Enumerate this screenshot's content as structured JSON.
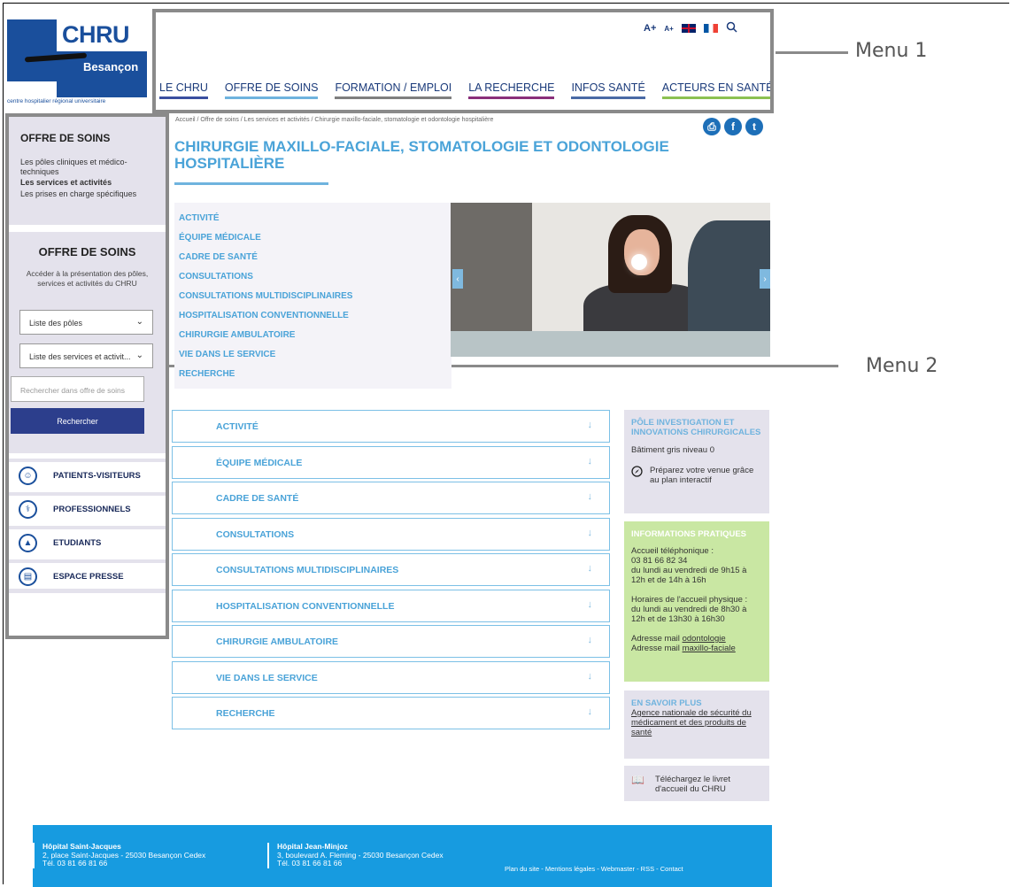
{
  "logo": {
    "name": "CHRU",
    "city": "Besançon",
    "tagline": "centre hospitalier régional universitaire"
  },
  "annotations": {
    "menu1": "Menu 1",
    "menu2": "Menu 2"
  },
  "tools": {
    "font_up": "A+",
    "font_down": "A+"
  },
  "topnav": [
    {
      "label": "LE CHRU",
      "color": "#3a4fa0"
    },
    {
      "label": "OFFRE DE SOINS",
      "color": "#6fb3de"
    },
    {
      "label": "FORMATION / EMPLOI",
      "color": "#7f7f7f"
    },
    {
      "label": "LA RECHERCHE",
      "color": "#8a2f7a"
    },
    {
      "label": "INFOS SANTÉ",
      "color": "#4a6aa5"
    },
    {
      "label": "ACTEURS EN SANTÉ",
      "color": "#8cc152"
    }
  ],
  "breadcrumb": "Accueil / Offre de soins / Les services et activités / Chirurgie maxillo-faciale, stomatologie et odontologie hospitalière",
  "page_title": "CHIRURGIE MAXILLO-FACIALE, STOMATOLOGIE ET ODONTOLOGIE HOSPITALIÈRE",
  "anchors": [
    "ACTIVITÉ",
    "ÉQUIPE MÉDICALE",
    "CADRE DE SANTÉ",
    "CONSULTATIONS",
    "CONSULTATIONS MULTIDISCIPLINAIRES",
    "HOSPITALISATION CONVENTIONNELLE",
    "CHIRURGIE AMBULATOIRE",
    "VIE DANS LE SERVICE",
    "RECHERCHE"
  ],
  "sidebar": {
    "heading": "OFFRE DE SOINS",
    "links": [
      "Les pôles cliniques et médico-techniques",
      "Les services et activités",
      "Les prises en charge spécifiques"
    ],
    "search_heading": "OFFRE DE SOINS",
    "search_desc": "Accéder à la présentation des pôles, services et activités du CHRU",
    "select_poles": "Liste des pôles",
    "select_services": "Liste des services et activit...",
    "search_placeholder": "Rechercher dans offre de soins",
    "search_button": "Rechercher",
    "quick_links": [
      "PATIENTS-VISITEURS",
      "PROFESSIONNELS",
      "ETUDIANTS",
      "ESPACE PRESSE"
    ]
  },
  "accordion": [
    "ACTIVITÉ",
    "ÉQUIPE MÉDICALE",
    "CADRE DE SANTÉ",
    "CONSULTATIONS",
    "CONSULTATIONS MULTIDISCIPLINAIRES",
    "HOSPITALISATION CONVENTIONNELLE",
    "CHIRURGIE AMBULATOIRE",
    "VIE DANS LE SERVICE",
    "RECHERCHE"
  ],
  "boxes": {
    "pole_title": "PÔLE INVESTIGATION ET INNOVATIONS CHIRURGICALES",
    "pole_building": "Bâtiment gris niveau 0",
    "pole_plan": "Préparez votre venue grâce au plan interactif",
    "info_title": "INFORMATIONS PRATIQUES",
    "info_phone_label": "Accueil téléphonique :",
    "info_phone": "03 81 66 82 34",
    "info_phone_hours": "du lundi au vendredi de 9h15 à 12h et de 14h à 16h",
    "info_physical_label": "Horaires de l'accueil physique :",
    "info_physical_hours": "du lundi au vendredi de 8h30 à 12h et de 13h30 à 16h30",
    "mail_prefix": "Adresse mail",
    "mail_1": "odontologie",
    "mail_2": "maxillo-faciale",
    "more_title": "EN SAVOIR PLUS",
    "more_link": "Agence nationale de sécurité du médicament et des produits de santé",
    "booklet": "Téléchargez le livret d'accueil du CHRU"
  },
  "footer": {
    "h1_name": "Hôpital Saint-Jacques",
    "h1_addr": "2, place Saint-Jacques - 25030 Besançon Cedex",
    "h1_tel": "Tél. 03 81 66 81 66",
    "h2_name": "Hôpital Jean-Minjoz",
    "h2_addr": "3, boulevard A. Fleming - 25030 Besançon Cedex",
    "h2_tel": "Tél. 03 81 66 81 66",
    "links": "Plan du site - Mentions légales - Webmaster - RSS - Contact"
  }
}
